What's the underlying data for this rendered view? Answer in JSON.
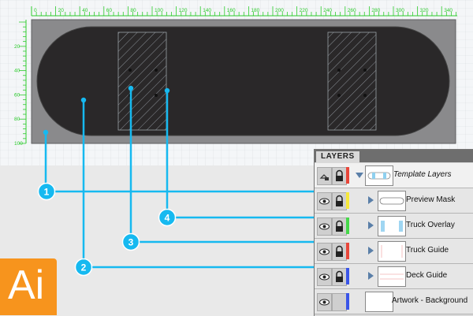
{
  "ruler": {
    "marks": [
      "0",
      "20",
      "40",
      "60",
      "80",
      "100",
      "120",
      "140",
      "160",
      "180",
      "200",
      "220",
      "240",
      "260",
      "280",
      "300",
      "320",
      "340"
    ],
    "vmarks": [
      "20",
      "40",
      "60",
      "80",
      "100"
    ]
  },
  "layers_panel": {
    "tab_label": "LAYERS",
    "rows": [
      {
        "name": "Template Layers",
        "color": "#e8463a",
        "italic": true
      },
      {
        "name": "Preview Mask",
        "color": "#f6e83b"
      },
      {
        "name": "Truck Overlay",
        "color": "#46d84a"
      },
      {
        "name": "Truck Guide",
        "color": "#e8463a"
      },
      {
        "name": "Deck Guide",
        "color": "#3a55e8"
      },
      {
        "name": "Artwork - Background",
        "color": "#3a55e8"
      }
    ]
  },
  "callouts": [
    "1",
    "2",
    "3",
    "4"
  ],
  "logo_text": "Ai",
  "colors": {
    "accent": "#16b9f0",
    "ruler_green": "#2ecc2e",
    "logo_orange": "#f7941d",
    "deck": "#2a2829",
    "artboard_gray": "#8a8a8c"
  }
}
